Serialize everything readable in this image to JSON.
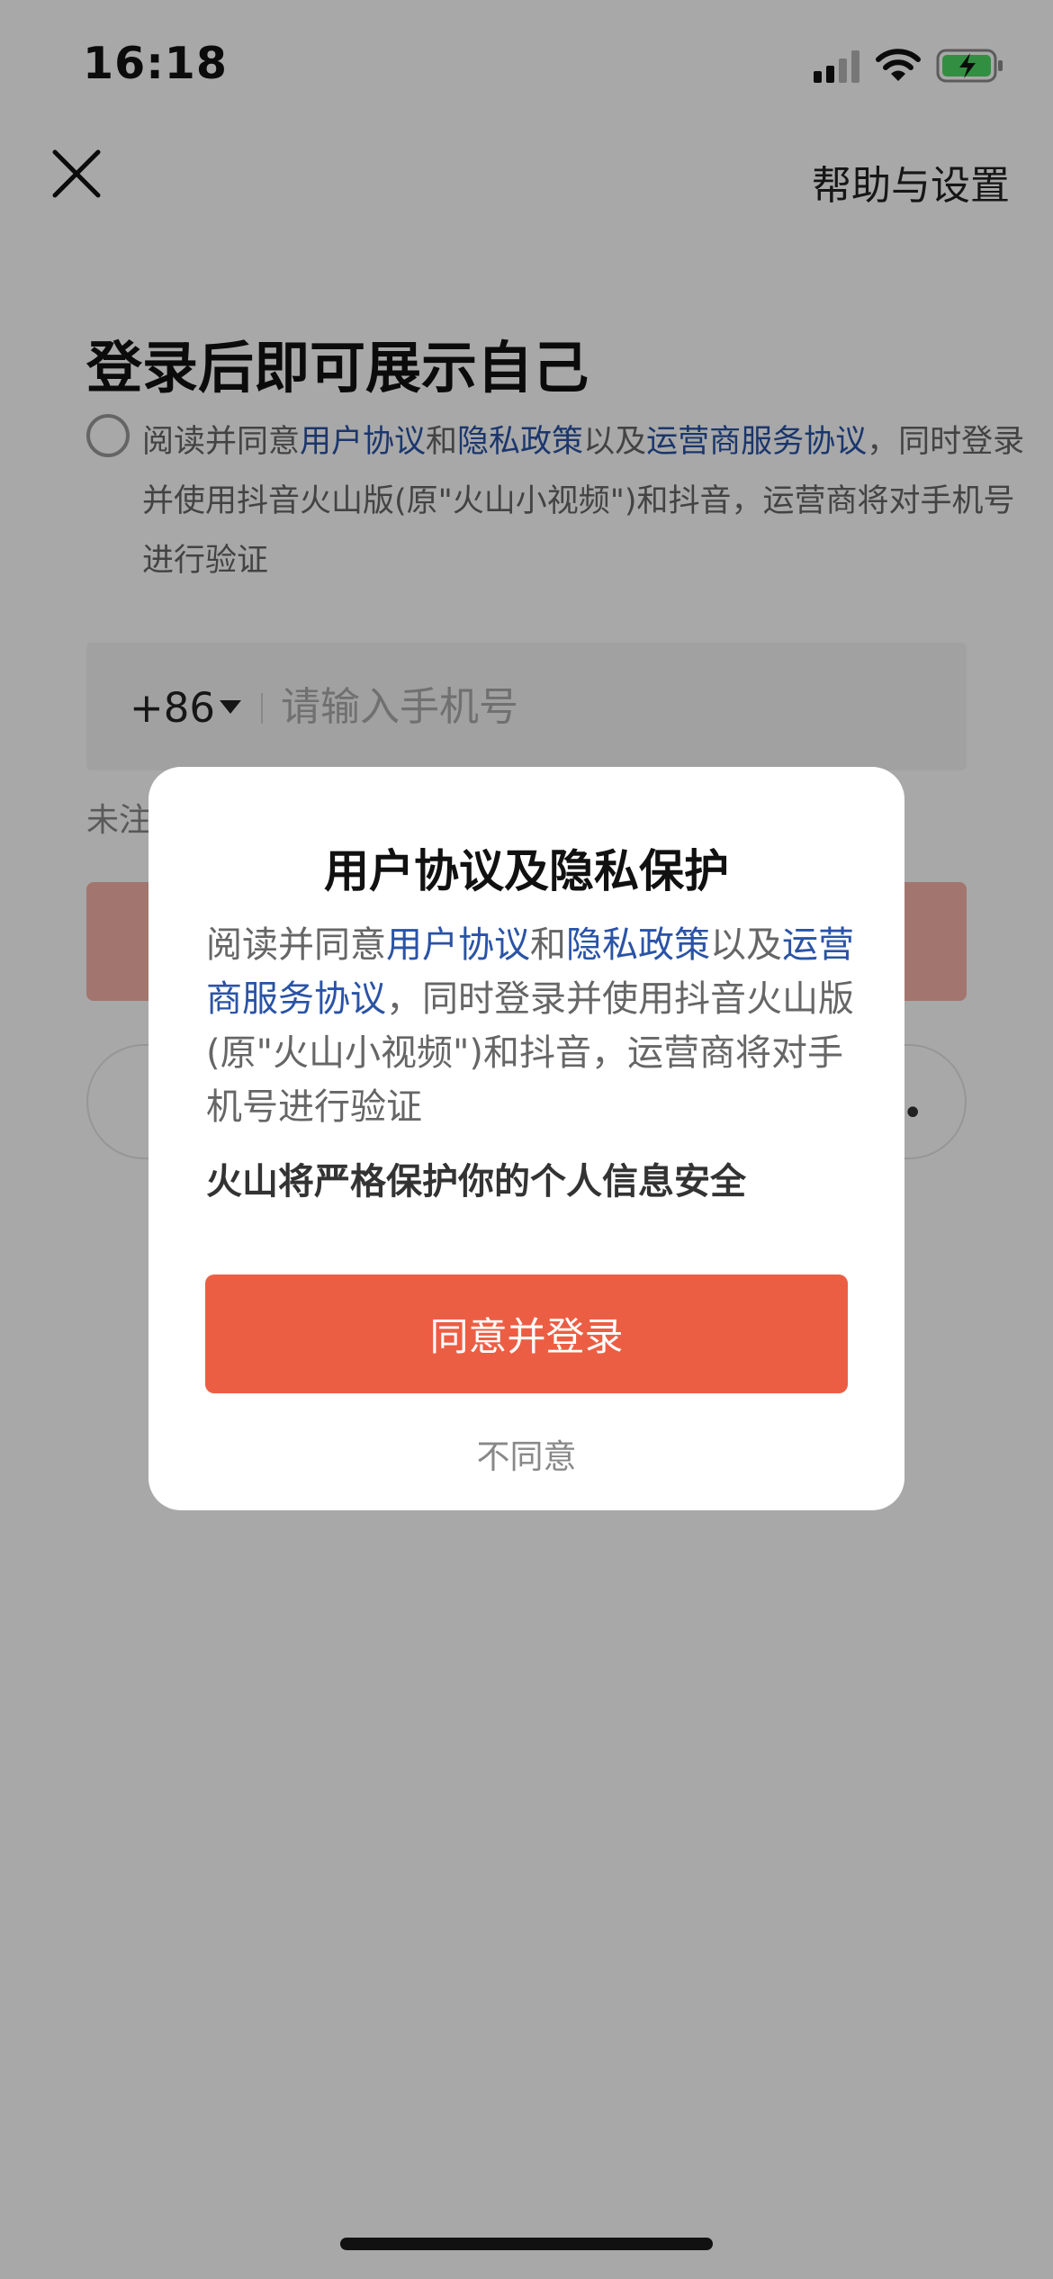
{
  "status_bar": {
    "time": "16:18"
  },
  "nav": {
    "close_icon": "close-icon",
    "help_label": "帮助与设置"
  },
  "login": {
    "title": "登录后即可展示自己",
    "agreement": {
      "prefix": "阅读并同意",
      "user_agreement": "用户协议",
      "and": "和",
      "privacy_policy": "隐私政策",
      "and2": "以及",
      "carrier_agreement": "运营商服务协议",
      "suffix": "，同时登录并使用抖音火山版(原\"火山小视频\")和抖音，运营商将对手机号进行验证"
    },
    "country_code": "+86",
    "phone_placeholder": "请输入手机号",
    "unregistered_hint": "未注"
  },
  "modal": {
    "title": "用户协议及隐私保护",
    "body": {
      "prefix": "阅读并同意",
      "user_agreement": "用户协议",
      "and": "和",
      "privacy_policy": "隐私政策",
      "and2": "以及",
      "carrier_agreement": "运营商服务协议",
      "suffix": "，同时登录并使用抖音火山版(原\"火山小视频\")和抖音，运营商将对手机号进行验证"
    },
    "notice": "火山将严格保护你的个人信息安全",
    "agree_button": "同意并登录",
    "disagree_label": "不同意"
  },
  "colors": {
    "accent": "#ec5e44",
    "link": "#2a53a5"
  }
}
